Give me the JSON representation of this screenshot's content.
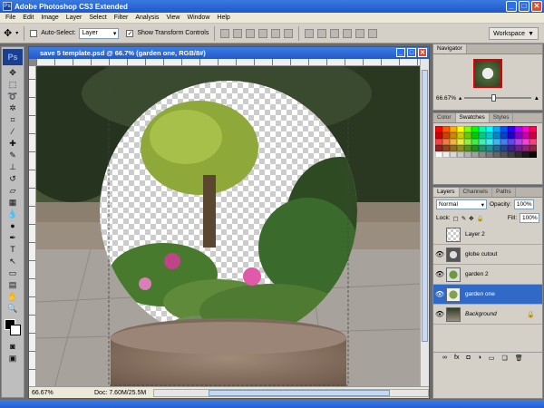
{
  "app": {
    "title": "Adobe Photoshop CS3 Extended"
  },
  "menu": [
    "File",
    "Edit",
    "Image",
    "Layer",
    "Select",
    "Filter",
    "Analysis",
    "View",
    "Window",
    "Help"
  ],
  "options": {
    "auto_select_label": "Auto-Select:",
    "auto_select_value": "Layer",
    "show_transform_label": "Show Transform Controls",
    "workspace_label": "Workspace"
  },
  "toolbar": {
    "logo": "Ps"
  },
  "document": {
    "title": "save 5 template.psd @ 66.7% (garden one, RGB/8#)",
    "zoom": "66.67%",
    "doc_size": "Doc: 7.60M/25.5M"
  },
  "navigator": {
    "tab": "Navigator",
    "zoom": "66.67%"
  },
  "color_panel": {
    "tabs": [
      "Color",
      "Swatches",
      "Styles"
    ],
    "active_tab": "Swatches"
  },
  "layers_panel": {
    "tabs": [
      "Layers",
      "Channels",
      "Paths"
    ],
    "blend_mode": "Normal",
    "opacity_label": "Opacity:",
    "opacity": "100%",
    "lock_label": "Lock:",
    "fill_label": "Fill:",
    "fill": "100%",
    "layers": [
      {
        "name": "Layer 2",
        "visible": false,
        "selected": false
      },
      {
        "name": "globe cutout",
        "visible": true,
        "selected": false
      },
      {
        "name": "garden 2",
        "visible": true,
        "selected": false
      },
      {
        "name": "garden one",
        "visible": true,
        "selected": true
      },
      {
        "name": "Background",
        "visible": true,
        "selected": false,
        "locked": true
      }
    ]
  },
  "colors": {
    "accent": "#3169c6",
    "titlebar": "#2458c6"
  }
}
